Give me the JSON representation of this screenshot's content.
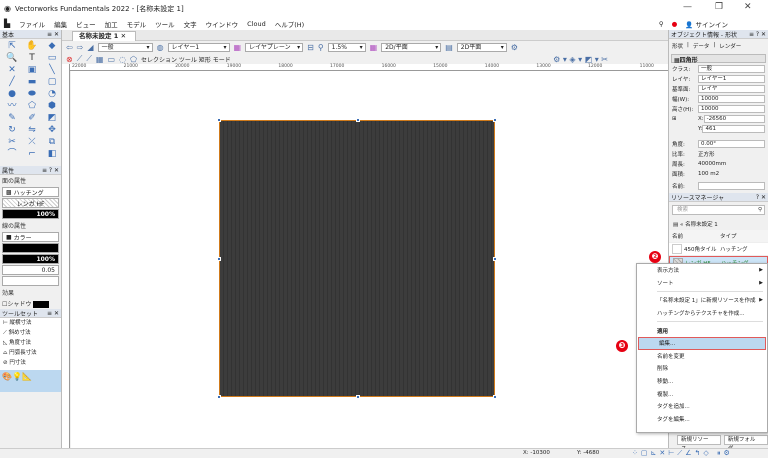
{
  "window": {
    "title": "Vectorworks Fundamentals 2022 - [名称未設定 1]",
    "minimize": "—",
    "restore": "❐",
    "close": "✕"
  },
  "menu": [
    "ファイル",
    "編集",
    "ビュー",
    "加工",
    "モデル",
    "ツール",
    "文字",
    "ウインドウ",
    "Cloud",
    "ヘルプ(H)"
  ],
  "signin": "サインイン",
  "palette": {
    "title": "基本",
    "attr_title": "属性",
    "fill_section": "面の属性",
    "fill_type": "ハッチング",
    "fill_name": "レンガ HF",
    "fill_opacity": "100%",
    "line_section": "線の属性",
    "line_type": "カラー",
    "line_opacity": "100%",
    "line_weight": "0.05",
    "effects": "効果",
    "shadow": "シャドウ",
    "toolset_title": "ツールセット",
    "toolset_items": [
      "縦横寸法",
      "斜め寸法",
      "角度寸法",
      "円弧長寸法",
      "円寸法"
    ]
  },
  "document": {
    "tab": "名称未設定 1"
  },
  "toolbar": {
    "class": "一般",
    "layer": "レイヤー1",
    "layer_plane": "レイヤプレーン",
    "zoom": "1.5%",
    "view": "2D/平面",
    "render": "2D平面",
    "mode_label": "セレクション ツール 矩形 モード"
  },
  "ruler": {
    "h": [
      "22000",
      "21000",
      "20000",
      "19000",
      "18000",
      "17000",
      "16000",
      "15000",
      "14000",
      "13000",
      "12000",
      "11000"
    ]
  },
  "object_info": {
    "title": "オブジェクト情報 - 形状",
    "tabs": [
      "形状",
      "データ",
      "レンダー"
    ],
    "type": "四角形",
    "fields": [
      {
        "label": "クラス:",
        "value": "一般"
      },
      {
        "label": "レイヤ:",
        "value": "レイヤー1"
      },
      {
        "label": "基準面:",
        "value": "レイヤ"
      },
      {
        "label": "幅(W):",
        "value": "10000"
      },
      {
        "label": "高さ(H):",
        "value": "10000"
      }
    ],
    "x_label": "X:",
    "x": "-26560",
    "y_label": "Y:",
    "y": "461",
    "angle_label": "角度:",
    "angle": "0.00°",
    "ratio_label": "比率:",
    "ratio": "正方形",
    "perimeter_label": "周長:",
    "perimeter": "40000mm",
    "area_label": "面積:",
    "area": "100 m2",
    "name_label": "名前:"
  },
  "resource_manager": {
    "title": "リソースマネージャ",
    "search_placeholder": "検索",
    "file": "名称未設定 1",
    "col_name": "名前",
    "col_type": "タイプ",
    "items": [
      {
        "name": "450角タイル",
        "type": "ハッチング"
      },
      {
        "name": "レンガ HF",
        "type": "ハッチング",
        "selected": true
      }
    ],
    "new_resource": "新規リソース...",
    "new_folder": "新規フォルダ..."
  },
  "context_menu": {
    "items": [
      "表示方法",
      "ソート",
      "「名称未設定 1」に新規リソースを作成",
      "ハッチングからテクスチャを作成...",
      "適用",
      "編集...",
      "名前を変更",
      "削除",
      "移動...",
      "複製...",
      "タグを追加...",
      "タグを編集..."
    ],
    "highlighted": "編集..."
  },
  "annotations": {
    "step2": "❷",
    "step3": "❸",
    "color": "#e60012"
  },
  "status": {
    "x": "X: -10300",
    "y": "Y: -4680"
  }
}
